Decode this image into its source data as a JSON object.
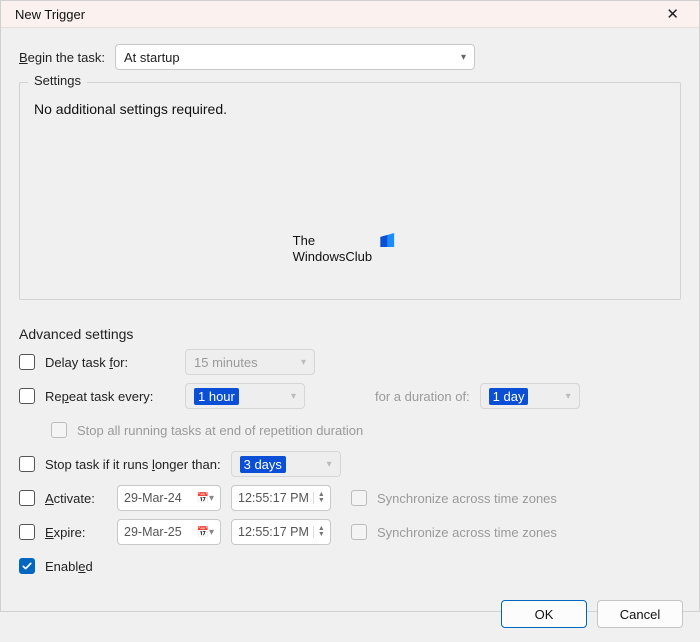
{
  "window": {
    "title": "New Trigger"
  },
  "begin": {
    "label_prefix": "B",
    "label_rest": "egin the task:",
    "selected": "At startup"
  },
  "settings_group": {
    "legend": "Settings",
    "message": "No additional settings required."
  },
  "watermark": {
    "line1": "The",
    "line2": "WindowsClub"
  },
  "advanced": {
    "title": "Advanced settings",
    "delay": {
      "label_prefix": "Delay task ",
      "label_u": "f",
      "label_rest": "or:",
      "value": "15 minutes"
    },
    "repeat": {
      "label_prefix": "Re",
      "label_u": "p",
      "label_rest": "eat task every:",
      "value": "1 hour",
      "duration_label": "for a duration of:",
      "duration_value": "1 day"
    },
    "stop_repetition": {
      "label": "Stop all running tasks at end of repetition duration"
    },
    "stop_long": {
      "label_prefix": "Stop task if it runs ",
      "label_u": "l",
      "label_rest": "onger than:",
      "value": "3 days"
    },
    "activate": {
      "label_u": "A",
      "label_rest": "ctivate:",
      "date": "29-Mar-24",
      "time": "12:55:17 PM",
      "sync_label": "Synchronize across time zones"
    },
    "expire": {
      "label_u": "E",
      "label_rest": "xpire:",
      "date": "29-Mar-25",
      "time": "12:55:17 PM",
      "sync_label": "Synchronize across time zones"
    },
    "enabled": {
      "label": "Enabl",
      "label_u": "e",
      "label_rest": "d"
    }
  },
  "buttons": {
    "ok": "OK",
    "cancel": "Cancel"
  }
}
